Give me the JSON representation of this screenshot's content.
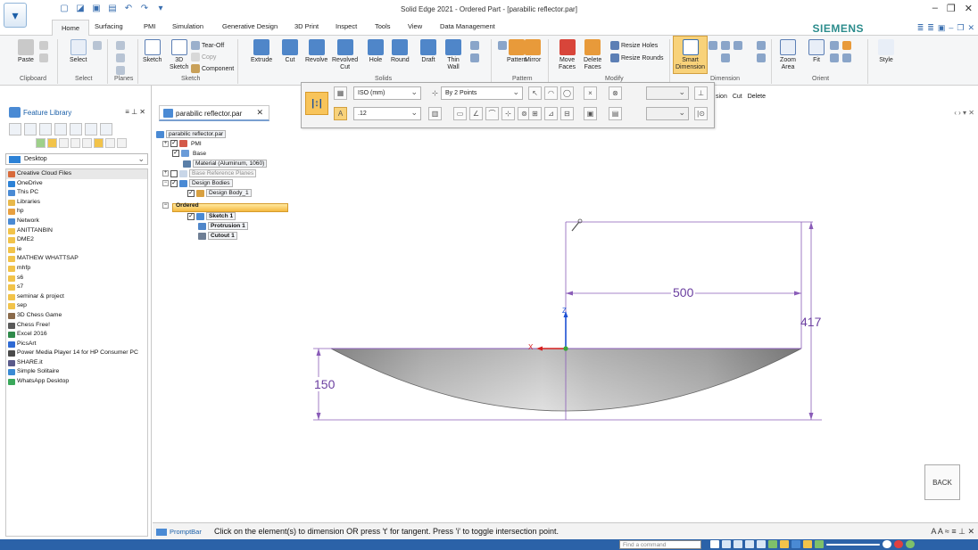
{
  "window": {
    "title": "Solid Edge 2021 - Ordered Part - [parabilic reflector.par]",
    "brand": "SIEMENS"
  },
  "tabs": [
    "Home",
    "Surfacing",
    "PMI",
    "Simulation",
    "Generative Design",
    "3D Print",
    "Inspect",
    "Tools",
    "View",
    "Data Management"
  ],
  "ribbon": {
    "clipboard": {
      "paste": "Paste",
      "group": "Clipboard"
    },
    "select": {
      "select": "Select",
      "group": "Select"
    },
    "planes": {
      "group": "Planes"
    },
    "sketch": {
      "sketch": "Sketch",
      "sketch3d": "3D\nSketch",
      "tearoff": "Tear-Off",
      "copy": "Copy",
      "component": "Component",
      "group": "Sketch"
    },
    "solids": {
      "extrude": "Extrude",
      "cut": "Cut",
      "revolve": "Revolve",
      "revolved_cut": "Revolved\nCut",
      "hole": "Hole",
      "round": "Round",
      "draft": "Draft",
      "thin_wall": "Thin\nWall",
      "group": "Solids"
    },
    "pattern": {
      "pattern": "Pattern",
      "mirror": "Mirror",
      "group": "Pattern"
    },
    "modify": {
      "move_faces": "Move\nFaces",
      "delete_faces": "Delete\nFaces",
      "resize_holes": "Resize Holes",
      "resize_rounds": "Resize Rounds",
      "group": "Modify"
    },
    "dimension": {
      "smart_dimension": "Smart\nDimension",
      "group": "Dimension"
    },
    "orient": {
      "zoom_area": "Zoom\nArea",
      "fit": "Fit",
      "group": "Orient"
    },
    "style": {
      "style": "Style"
    }
  },
  "command_bar": {
    "units": "ISO (mm)",
    "method": "By 2 Points",
    "size": ".12"
  },
  "ribbon_extra": {
    "items": [
      "sion",
      "Cut",
      "Delete"
    ]
  },
  "feature_library": {
    "title": "Feature Library",
    "location": "Desktop",
    "items": [
      "Creative Cloud Files",
      "OneDrive",
      "This PC",
      "Libraries",
      "hp",
      "Network",
      "ANITTANBIN",
      "DME2",
      "ie",
      "MATHEW WHATTSAP",
      "mhfp",
      "s6",
      "s7",
      "seminar & project",
      "sep",
      "3D Chess Game",
      "Chess Free!",
      "Excel 2016",
      "PicsArt",
      "Power Media Player 14 for HP Consumer PC",
      "SHARE.it",
      "Simple Solitaire",
      "WhatsApp Desktop"
    ]
  },
  "document_tab": {
    "name": "parabilic reflector.par"
  },
  "tree": {
    "root": "parabilic reflector.par",
    "pmi": "PMI",
    "base": "Base",
    "material": "Material (Aluminum, 1060)",
    "base_ref_planes": "Base Reference Planes",
    "design_bodies": "Design Bodies",
    "design_body_1": "Design Body_1",
    "ordered": "Ordered",
    "sketch1": "Sketch 1",
    "protrusion1": "Protrusion 1",
    "cutout1": "Cutout 1"
  },
  "dimensions": {
    "width": "500",
    "height": "417",
    "depth": "150"
  },
  "axis_labels": {
    "z": "Z",
    "x": "X"
  },
  "back_button": "BACK",
  "prompt_bar": {
    "label": "PromptBar",
    "text": "Click on the element(s) to dimension OR press 't' for tangent.   Press 'i' to toggle intersection point."
  },
  "status_bar": {
    "find_placeholder": "Find a command"
  },
  "colors": {
    "accent": "#2b62a8",
    "dimension": "#6b3fa0",
    "brand": "#2b8c8c",
    "highlight": "#f5b940"
  }
}
